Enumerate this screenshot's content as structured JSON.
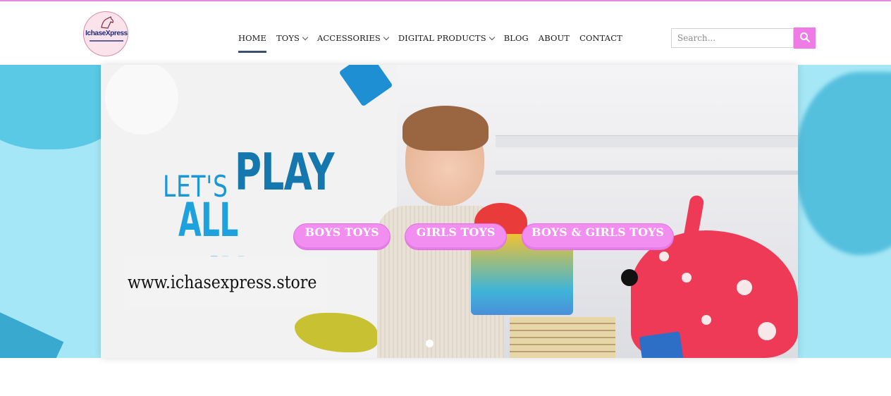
{
  "brand": {
    "logo_text": "IchaseXpress",
    "accent_color": "#ef7be7",
    "topline_color": "#e28be3"
  },
  "nav": {
    "items": [
      {
        "label": "HOME",
        "dropdown": false,
        "active": true
      },
      {
        "label": "TOYS",
        "dropdown": true,
        "active": false
      },
      {
        "label": "ACCESSORIES",
        "dropdown": true,
        "active": false
      },
      {
        "label": "DIGITAL PRODUCTS",
        "dropdown": true,
        "active": false
      },
      {
        "label": "BLOG",
        "dropdown": false,
        "active": false
      },
      {
        "label": "ABOUT",
        "dropdown": false,
        "active": false
      },
      {
        "label": "CONTACT",
        "dropdown": false,
        "active": false
      }
    ]
  },
  "search": {
    "placeholder": "Search...",
    "value": "",
    "button_icon": "search-icon"
  },
  "hero": {
    "headline_lets": "LET'S",
    "headline_play": "PLAY",
    "headline_allday": "ALL DAY",
    "url": "www.ichasexpress.store",
    "buttons": {
      "boys": "BOYS TOYS",
      "girls": "GIRLS TOYS",
      "both": "BOYS & GIRLS TOYS"
    },
    "pill_color": "#f18ef0",
    "background_color": "#a5e7f6"
  }
}
